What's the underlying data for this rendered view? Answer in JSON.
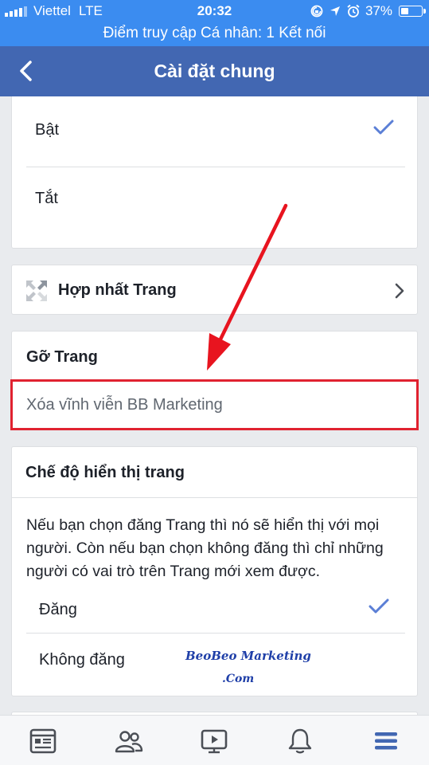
{
  "status_bar": {
    "carrier": "Viettel",
    "network": "LTE",
    "time": "20:32",
    "battery_percent": "37%",
    "battery_level": 0.37
  },
  "hotspot_banner": "Điểm truy cập Cá nhân: 1 Kết nối",
  "navbar": {
    "title": "Cài đặt chung",
    "back_icon": "chevron-left-icon"
  },
  "visibility_options_top": {
    "on_label": "Bật",
    "off_label": "Tắt",
    "selected": "Bật"
  },
  "merge_pages": {
    "label": "Hợp nhất Trang",
    "icon": "merge-arrows-icon"
  },
  "remove_page": {
    "title": "Gỡ Trang",
    "action": "Xóa vĩnh viễn BB Marketing"
  },
  "page_visibility": {
    "title": "Chế độ hiển thị trang",
    "description": "Nếu bạn chọn đăng Trang thì nó sẽ hiển thị với mọi người. Còn nếu bạn chọn không đăng thì chỉ những người có vai trò trên Trang mới xem được.",
    "options": [
      "Đăng",
      "Không đăng"
    ],
    "selected": "Đăng"
  },
  "watermark": {
    "line1": "BeoBeo Marketing",
    "line2": ".Com"
  },
  "tab_bar": {
    "tabs": [
      "news-feed-icon",
      "groups-icon",
      "watch-video-icon",
      "notifications-bell-icon",
      "menu-icon"
    ],
    "active_color": "#4267b2"
  },
  "colors": {
    "navbar": "#4267b2",
    "status": "#3b8cf0",
    "accent_check": "#4267b2",
    "highlight": "#e02230"
  }
}
